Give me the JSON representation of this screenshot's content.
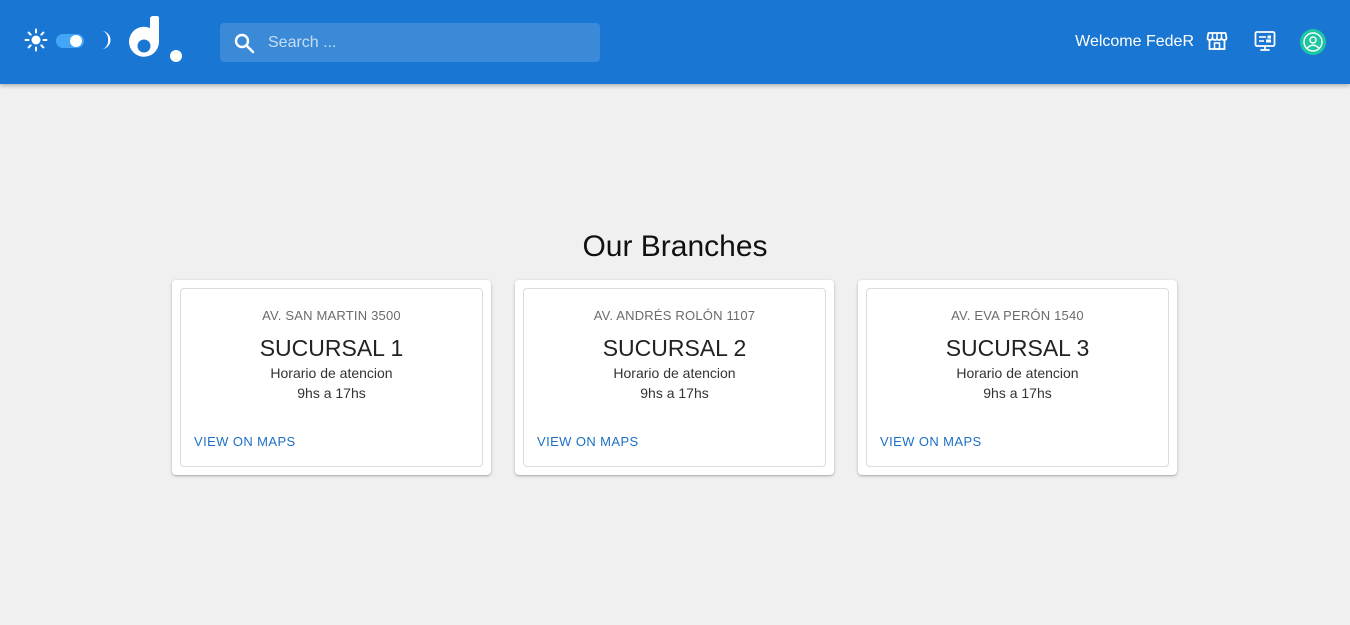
{
  "header": {
    "search_placeholder": "Search ...",
    "welcome": "Welcome FedeR",
    "theme_toggle_on": true,
    "colors": {
      "appbar": "#1976d2",
      "avatar": "#1dc7a2"
    },
    "icons": [
      "light-mode-icon",
      "dark-mode-icon",
      "store-icon",
      "panel-icon",
      "account-icon",
      "search-icon"
    ]
  },
  "main": {
    "title": "Our Branches",
    "branches": [
      {
        "address": "AV. SAN MARTIN 3500",
        "name": "SUCURSAL 1",
        "hours_label": "Horario de atencion",
        "hours": "9hs a 17hs",
        "maps_label": "VIEW ON MAPS"
      },
      {
        "address": "AV. ANDRÉS ROLÓN 1107",
        "name": "SUCURSAL 2",
        "hours_label": "Horario de atencion",
        "hours": "9hs a 17hs",
        "maps_label": "VIEW ON MAPS"
      },
      {
        "address": "AV. EVA PERÓN 1540",
        "name": "SUCURSAL 3",
        "hours_label": "Horario de atencion",
        "hours": "9hs a 17hs",
        "maps_label": "VIEW ON MAPS"
      }
    ]
  }
}
